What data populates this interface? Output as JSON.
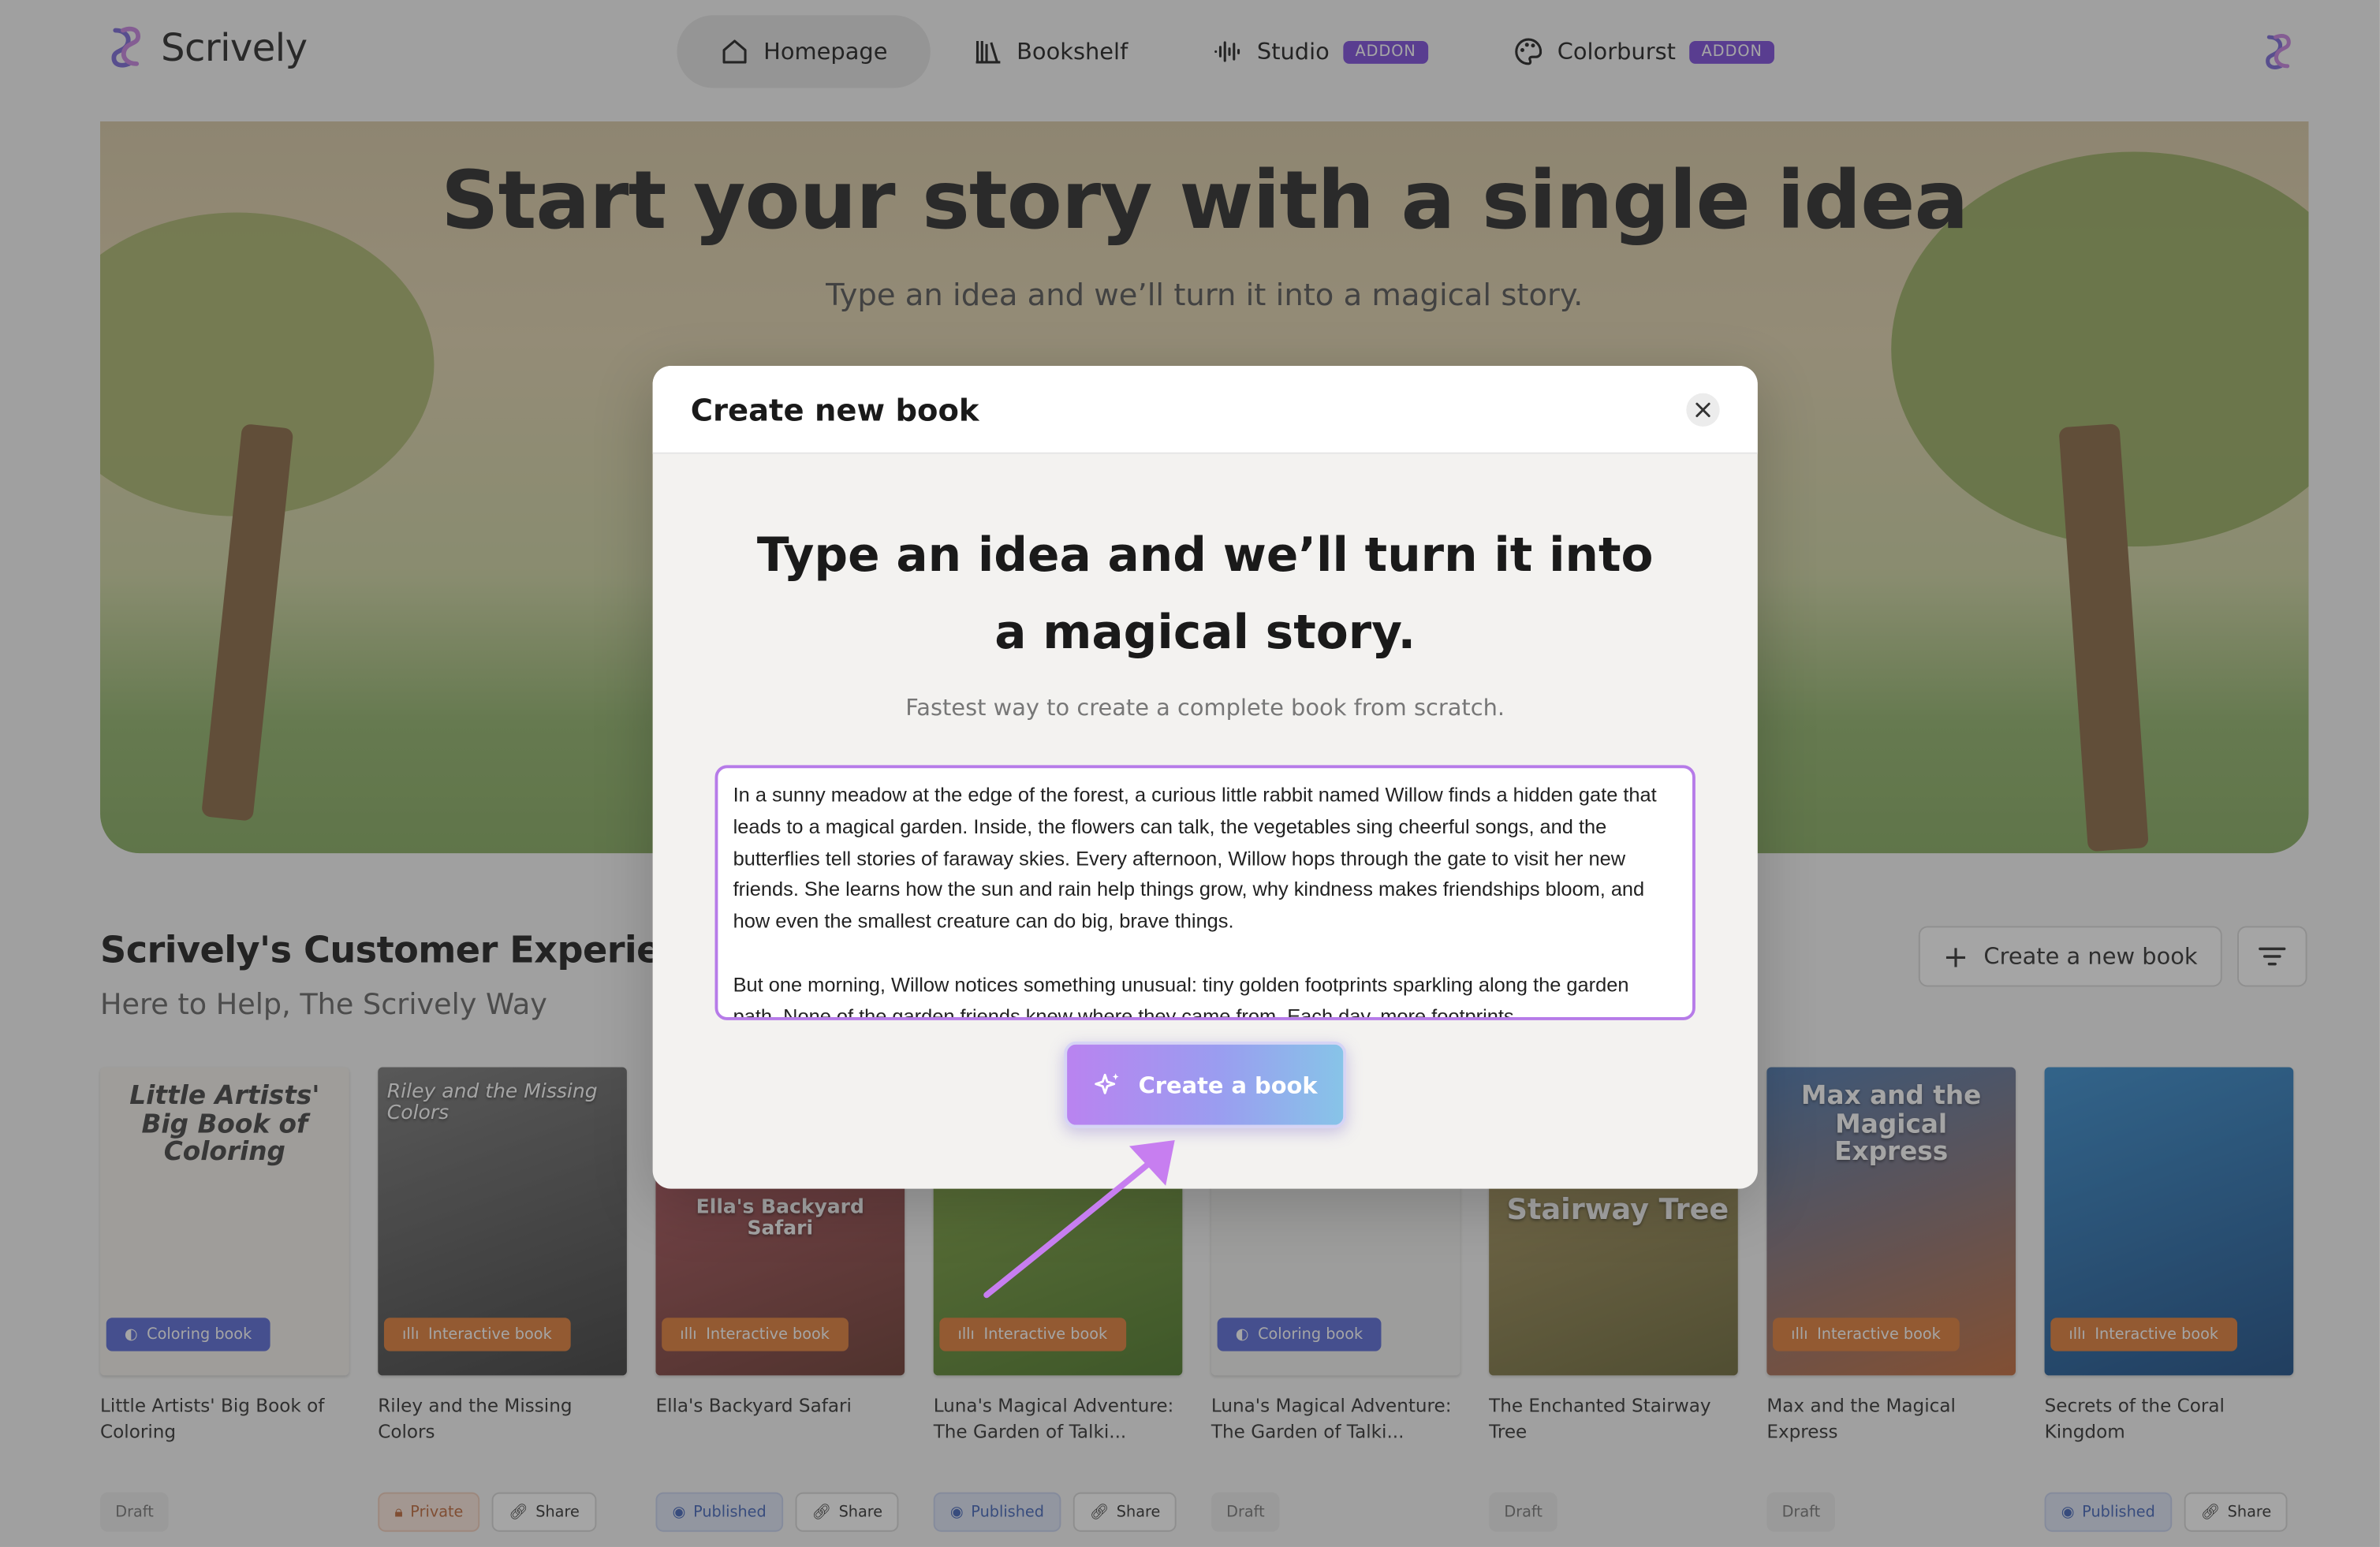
{
  "brand": {
    "name": "Scrively"
  },
  "nav": {
    "items": [
      {
        "label": "Homepage",
        "active": true
      },
      {
        "label": "Bookshelf"
      },
      {
        "label": "Studio",
        "badge": "ADDON"
      },
      {
        "label": "Colorburst",
        "badge": "ADDON"
      }
    ]
  },
  "hero": {
    "title": "Start your story with a single idea",
    "subtitle": "Type an idea and we’ll turn it into a magical story."
  },
  "section": {
    "title": "Scrively's Customer Experience",
    "subtitle": "Here to Help, The Scrively Way",
    "create_label": "Create a new book"
  },
  "books": [
    {
      "title": "Little Artists' Big Book of Coloring",
      "cover_title": "Little Artists' Big Book of Coloring",
      "type": "Coloring book",
      "status": "Draft",
      "share": ""
    },
    {
      "title": "Riley and the Missing Colors",
      "cover_title": "Riley and the Missing Colors",
      "type": "Interactive book",
      "status": "Private",
      "share": "Share"
    },
    {
      "title": "Ella's Backyard Safari",
      "cover_title": "Ella's Backyard Safari",
      "type": "Interactive book",
      "status": "Published",
      "share": "Share"
    },
    {
      "title": "Luna's Magical Adventure: The Garden of Talki...",
      "cover_title": "",
      "type": "Interactive book",
      "status": "Published",
      "share": "Share"
    },
    {
      "title": "Luna's Magical Adventure: The Garden of Talki...",
      "cover_title": "",
      "type": "Coloring book",
      "status": "Draft",
      "share": ""
    },
    {
      "title": "The Enchanted Stairway Tree",
      "cover_title": "Stairway Tree",
      "type": "",
      "status": "Draft",
      "share": ""
    },
    {
      "title": "Max and the Magical Express",
      "cover_title": "Max and the Magical Express",
      "type": "Interactive book",
      "status": "Draft",
      "share": ""
    },
    {
      "title": "Secrets of the Coral Kingdom",
      "cover_title": "",
      "type": "Interactive book",
      "status": "Published",
      "share": "Share"
    }
  ],
  "modal": {
    "title": "Create new book",
    "heading": "Type an idea and we’ll turn it into a magical story.",
    "subheading": "Fastest way to create a complete book from scratch.",
    "idea_text": "In a sunny meadow at the edge of the forest, a curious little rabbit named Willow finds a hidden gate that leads to a magical garden. Inside, the flowers can talk, the vegetables sing cheerful songs, and the butterflies tell stories of faraway skies. Every afternoon, Willow hops through the gate to visit her new friends. She learns how the sun and rain help things grow, why kindness makes friendships bloom, and how even the smallest creature can do big, brave things.\n\nBut one morning, Willow notices something unusual: tiny golden footprints sparkling along the garden path. None of the garden friends knew where they came from. Each day, more footprints",
    "button_label": "Create a book"
  },
  "colors": {
    "accent": "#7c4ddb",
    "textarea_border": "#b67be8",
    "button_gradient_start": "#b983f0",
    "button_gradient_end": "#87c4e8"
  }
}
